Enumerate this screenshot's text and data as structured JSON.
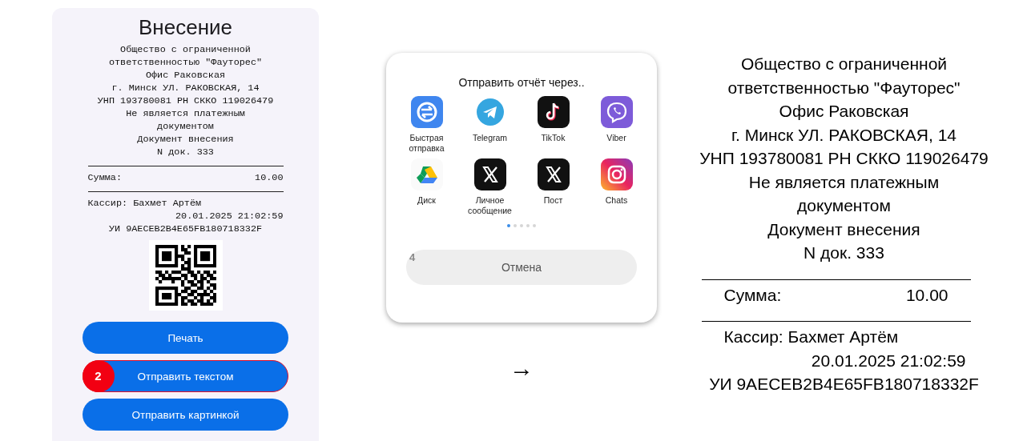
{
  "receipt_screen": {
    "title": "Внесение",
    "receipt_lines": [
      {
        "kind": "center",
        "text": "Общество с ограниченной"
      },
      {
        "kind": "center",
        "text": "ответственностью \"Фауторес\""
      },
      {
        "kind": "center",
        "text": "Офис Раковская"
      },
      {
        "kind": "center",
        "text": "г. Минск УЛ. РАКОВСКАЯ, 14"
      },
      {
        "kind": "center",
        "text": "УНП 193780081 РН СККО 119026479"
      },
      {
        "kind": "center",
        "text": "Не является платежным"
      },
      {
        "kind": "center",
        "text": "документом"
      },
      {
        "kind": "center",
        "text": "Документ внесения"
      },
      {
        "kind": "center",
        "text": "N док. 333"
      },
      {
        "kind": "divider"
      },
      {
        "kind": "row",
        "label": "Сумма:",
        "value": "10.00"
      },
      {
        "kind": "divider"
      },
      {
        "kind": "left",
        "text": "Кассир: Бахмет Артём"
      },
      {
        "kind": "right",
        "text": "20.01.2025 21:02:59"
      },
      {
        "kind": "center",
        "text": "УИ 9AECEB2B4E65FB180718332F"
      }
    ],
    "buttons": [
      {
        "label": "Печать",
        "selected": false
      },
      {
        "label": "Отправить текстом",
        "selected": true,
        "step_badge": "2"
      },
      {
        "label": "Отправить картинкой",
        "selected": false
      }
    ]
  },
  "share_sheet": {
    "title": "Отправить отчёт через..",
    "apps": [
      {
        "kind": "quick-share",
        "label": "Быстрая отправка"
      },
      {
        "kind": "telegram",
        "label": "Telegram"
      },
      {
        "kind": "tiktok",
        "label": "TikTok"
      },
      {
        "kind": "viber",
        "label": "Viber"
      },
      {
        "kind": "drive",
        "label": "Диск"
      },
      {
        "kind": "x",
        "label": "Личное сообщение"
      },
      {
        "kind": "x",
        "label": "Пост"
      },
      {
        "kind": "instagram",
        "label": "Chats"
      }
    ],
    "page_dots": [
      {
        "selected": true
      },
      {
        "selected": false
      },
      {
        "selected": false
      },
      {
        "selected": false
      },
      {
        "selected": false
      }
    ],
    "cancel_button": {
      "label": "Отмена",
      "step_badge": "4"
    }
  },
  "arrow": "→",
  "text_output": {
    "lines": [
      {
        "kind": "center",
        "text": "Общество с ограниченной"
      },
      {
        "kind": "center",
        "text": "ответственностью \"Фауторес\""
      },
      {
        "kind": "center",
        "text": "Офис Раковская"
      },
      {
        "kind": "center",
        "text": "г. Минск УЛ. РАКОВСКАЯ, 14"
      },
      {
        "kind": "center",
        "text": "УНП 193780081 РН СККО 119026479"
      },
      {
        "kind": "center",
        "text": "Не является платежным"
      },
      {
        "kind": "center",
        "text": "документом"
      },
      {
        "kind": "center",
        "text": "Документ внесения"
      },
      {
        "kind": "center",
        "text": "N док. 333"
      },
      {
        "kind": "divider"
      },
      {
        "kind": "row",
        "label": "Сумма:",
        "value": "10.00"
      },
      {
        "kind": "divider"
      },
      {
        "kind": "left",
        "text": "Кассир: Бахмет Артём"
      },
      {
        "kind": "right",
        "text": "20.01.2025 21:02:59"
      },
      {
        "kind": "center",
        "text": "УИ 9AECEB2B4E65FB180718332F"
      }
    ]
  }
}
